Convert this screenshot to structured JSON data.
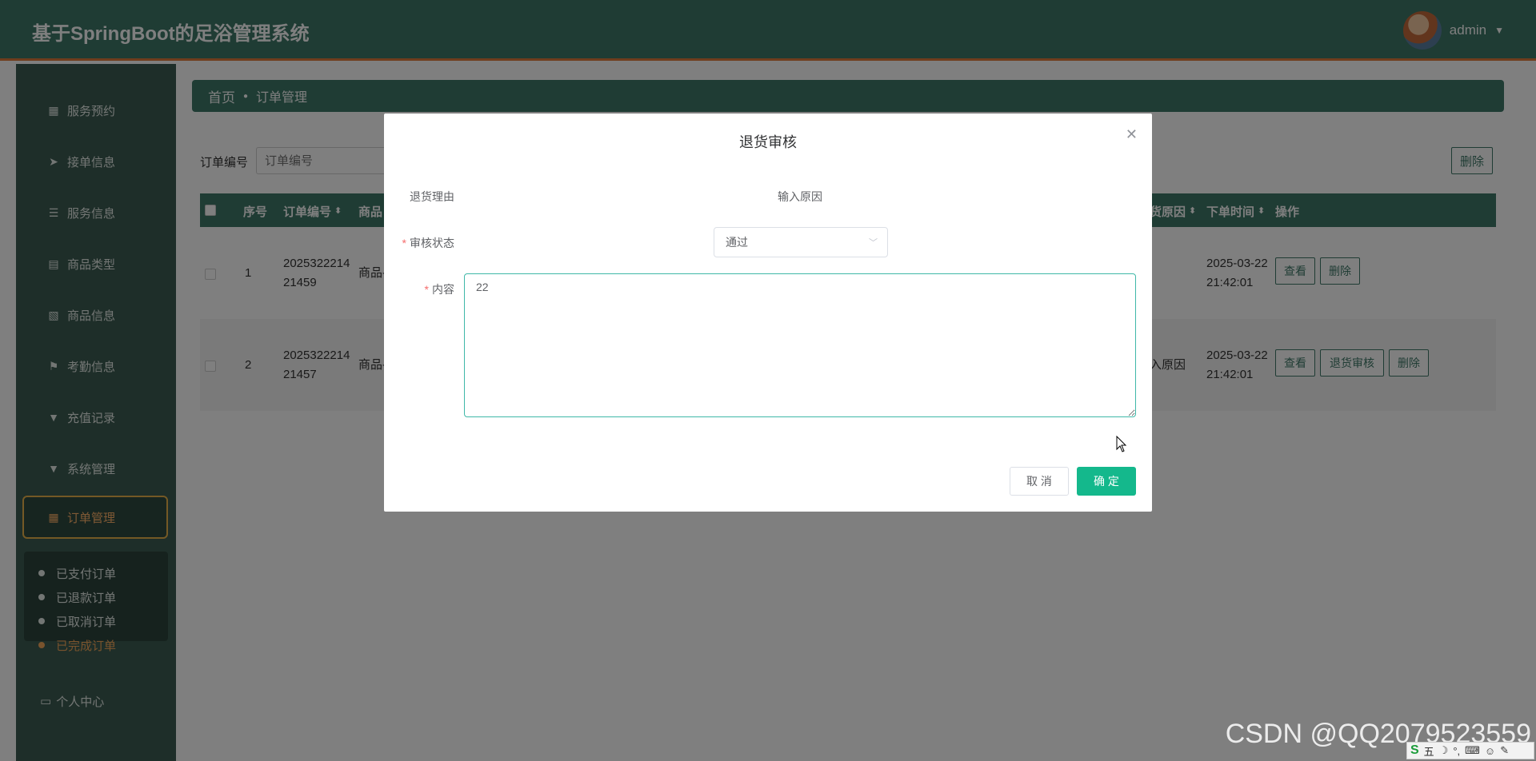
{
  "header": {
    "app_title": "基于SpringBoot的足浴管理系统",
    "user_name": "admin"
  },
  "sidebar": {
    "items": [
      {
        "label": "服务预约",
        "icon": "grid-icon"
      },
      {
        "label": "接单信息",
        "icon": "send-icon"
      },
      {
        "label": "服务信息",
        "icon": "list-icon"
      },
      {
        "label": "商品类型",
        "icon": "clipboard-icon"
      },
      {
        "label": "商品信息",
        "icon": "clipboard-x-icon"
      },
      {
        "label": "考勤信息",
        "icon": "flag-icon"
      },
      {
        "label": "充值记录",
        "icon": "pin-icon"
      },
      {
        "label": "系统管理",
        "icon": "pin-icon"
      },
      {
        "label": "订单管理",
        "icon": "grid-icon"
      }
    ],
    "sub_items": [
      {
        "label": "已支付订单"
      },
      {
        "label": "已退款订单"
      },
      {
        "label": "已取消订单"
      },
      {
        "label": "已完成订单"
      }
    ],
    "personal_center": "个人中心"
  },
  "breadcrumb": {
    "home": "首页",
    "current": "订单管理"
  },
  "search": {
    "label": "订单编号",
    "placeholder": "订单编号",
    "delete_label": "删除"
  },
  "table": {
    "headers": {
      "index": "序号",
      "order_no": "订单编号",
      "goods": "商品",
      "reason": "货原因",
      "time": "下单时间",
      "actions": "操作"
    },
    "rows": [
      {
        "index": "1",
        "order_no_1": "2025322214",
        "order_no_2": "21459",
        "goods": "商品-",
        "reason": "",
        "time_1": "2025-03-22",
        "time_2": "21:42:01",
        "view": "查看",
        "delete": "删除"
      },
      {
        "index": "2",
        "order_no_1": "2025322214",
        "order_no_2": "21457",
        "goods": "商品-",
        "reason": "入原因",
        "time_1": "2025-03-22",
        "time_2": "21:42:01",
        "view": "查看",
        "audit": "退货审核",
        "delete": "删除"
      }
    ]
  },
  "dialog": {
    "title": "退货审核",
    "reason_label": "退货理由",
    "reason_value": "输入原因",
    "status_label": "审核状态",
    "status_value": "通过",
    "content_label": "内容",
    "content_value": "22",
    "cancel_label": "取 消",
    "ok_label": "确 定"
  },
  "watermark": "CSDN @QQ2079523559",
  "ime": {
    "logo": "S",
    "mode": "五"
  }
}
